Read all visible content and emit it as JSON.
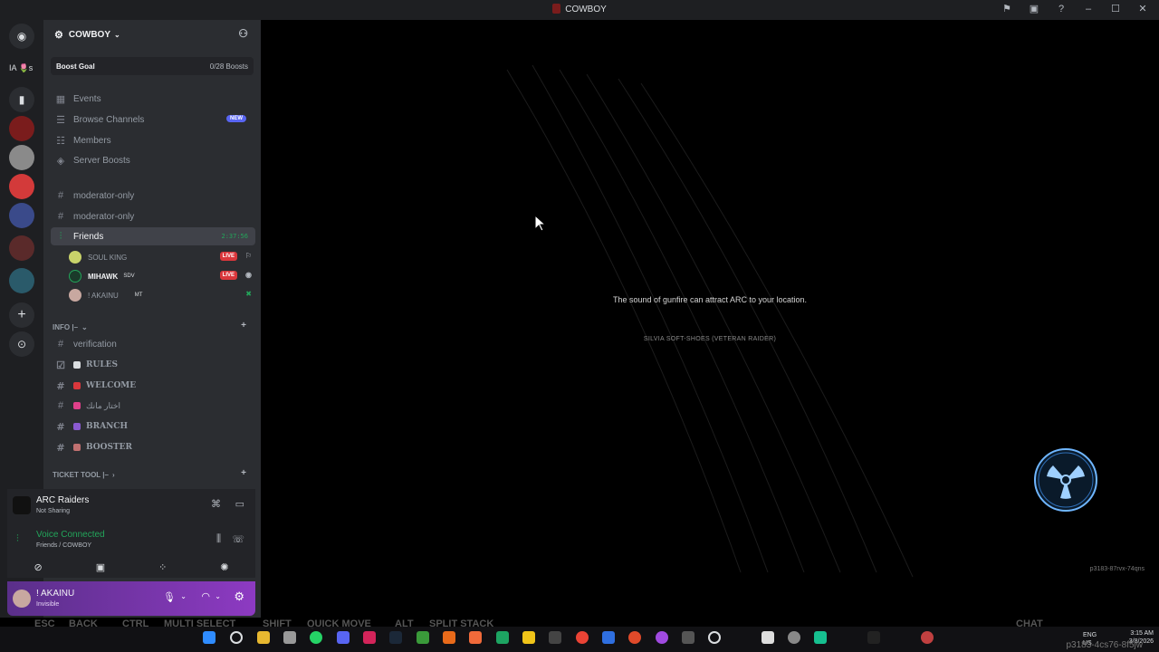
{
  "window": {
    "title": "COWBOY"
  },
  "rail": {
    "label": "IA 🌷s"
  },
  "server": {
    "name": "COWBOY",
    "boost": {
      "label": "Boost Goal",
      "progress": "0/28 Boosts"
    }
  },
  "nav_items": [
    {
      "label": "Events",
      "icon": "calendar-icon"
    },
    {
      "label": "Browse Channels",
      "icon": "browse-icon",
      "badge": "NEW"
    },
    {
      "label": "Members",
      "icon": "members-icon"
    },
    {
      "label": "Server Boosts",
      "icon": "boost-icon"
    }
  ],
  "channels": [
    {
      "label": "moderator-only"
    },
    {
      "label": "moderator-only"
    }
  ],
  "voice_channel": {
    "label": "Friends",
    "timer": "2:37:56",
    "members": [
      {
        "name": "SOUL KING",
        "live": "LIVE"
      },
      {
        "name": "MIHAWK",
        "tag": "SDV",
        "live": "LIVE"
      },
      {
        "name": "! AKAINU",
        "tag": "MT"
      }
    ]
  },
  "categories": {
    "info": "INFO |–",
    "ticket": "TICKET TOOL |–"
  },
  "info_channels": [
    {
      "label": "verification"
    },
    {
      "label": "RULES"
    },
    {
      "label": "WELCOME"
    },
    {
      "label": "اختار مانك"
    },
    {
      "label": "BRANCH"
    },
    {
      "label": "BOOSTER"
    }
  ],
  "activity": {
    "game": "ARC Raiders",
    "status": "Not Sharing"
  },
  "voice_status": {
    "title": "Voice Connected",
    "location": "Friends / COWBOY"
  },
  "user": {
    "name": "! AKAINU",
    "status": "Invisible"
  },
  "game": {
    "tip": "The sound of gunfire can attract ARC to your location.",
    "quote": "SILVIA SOFT-SHOES (VETERAN RAIDER)",
    "build": "p3183-87rvx-74qns"
  },
  "hints": [
    {
      "key": "ESC",
      "label": "BACK"
    },
    {
      "key": "CTRL",
      "label": "MULTI SELECT"
    },
    {
      "key": "SHIFT",
      "label": "QUICK MOVE"
    },
    {
      "key": "ALT",
      "label": "SPLIT STACK"
    },
    {
      "key": "",
      "label": "CHAT"
    }
  ],
  "tray": {
    "lang1": "ENG",
    "lang2": "US",
    "time": "3:15 AM",
    "date": "3/8/2026",
    "ghost_build": "p3183-4cs76-8f5jw"
  },
  "colors": {
    "accent": "#5865f2",
    "live": "#da373c",
    "online": "#23a55a",
    "userbar": "#8d3ac2"
  }
}
